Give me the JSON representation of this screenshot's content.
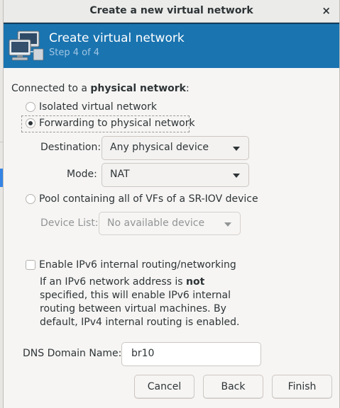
{
  "window": {
    "title": "Create a new virtual network",
    "close_glyph": "×"
  },
  "banner": {
    "icon": "network-computers-icon",
    "heading": "Create virtual network",
    "step": "Step 4 of 4"
  },
  "connected": {
    "prefix": "Connected to a ",
    "bold": "physical network",
    "suffix": ":"
  },
  "options": {
    "isolated": {
      "label": "Isolated virtual network",
      "selected": false
    },
    "forwarding": {
      "label": "Forwarding to physical network",
      "selected": true
    },
    "sriov": {
      "label": "Pool containing all of VFs of a SR-IOV device",
      "selected": false
    }
  },
  "forwarding_fields": {
    "destination_label": "Destination:",
    "destination_value": "Any physical device",
    "mode_label": "Mode:",
    "mode_value": "NAT"
  },
  "sriov_fields": {
    "device_list_label": "Device List:",
    "device_list_value": "No available device"
  },
  "ipv6": {
    "label": "Enable IPv6 internal routing/networking",
    "checked": false,
    "help_line1_a": "If an IPv6 network address is ",
    "help_line1_bold": "not",
    "help_line2": "specified, this will enable IPv6 internal",
    "help_line3": "routing between virtual machines.  By",
    "help_line4": "default, IPv4 internal routing is enabled."
  },
  "dns": {
    "label": "DNS Domain Name:",
    "value": "br10"
  },
  "buttons": {
    "cancel": "Cancel",
    "back": "Back",
    "finish": "Finish"
  },
  "colors": {
    "banner": "#1a74b0",
    "banner_subtitle": "#9fc6e4",
    "selection_accent": "#3584e4"
  }
}
